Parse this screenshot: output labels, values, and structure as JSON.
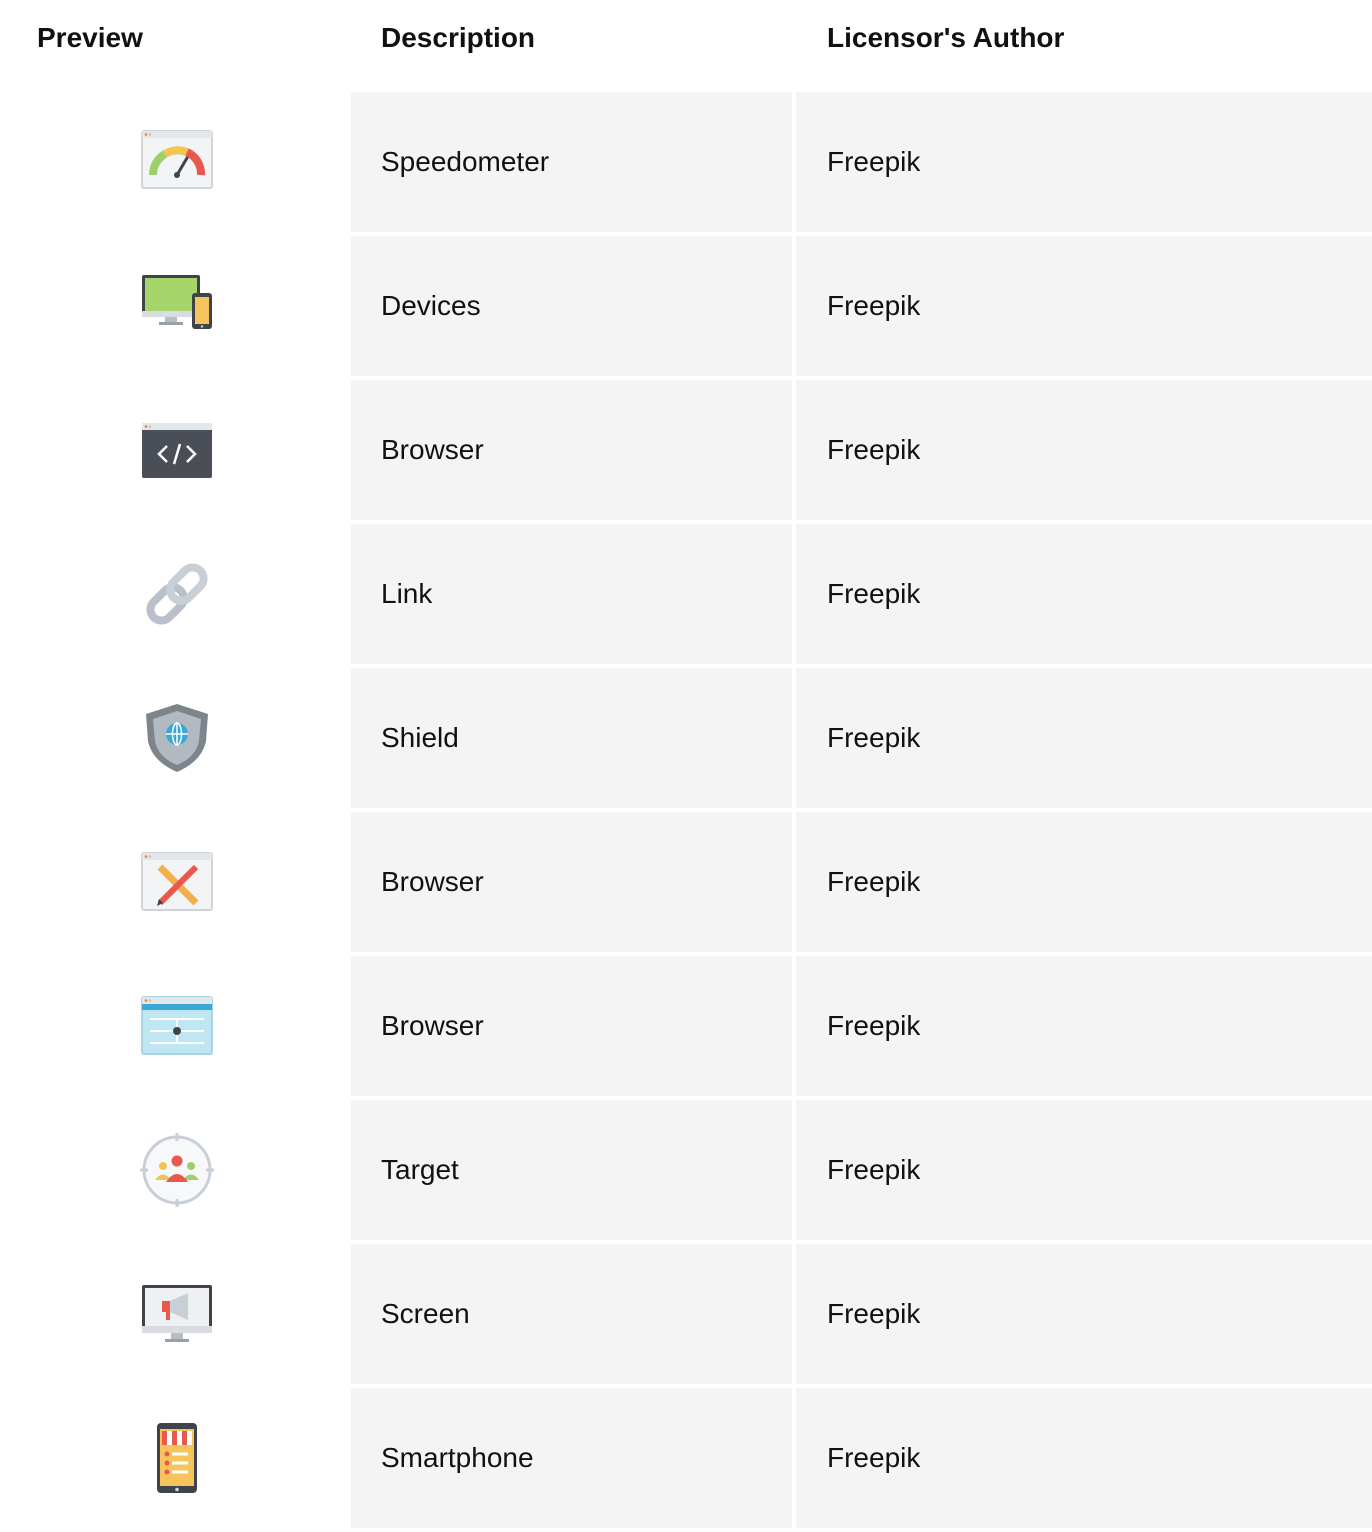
{
  "table": {
    "headers": {
      "preview": "Preview",
      "description": "Description",
      "author": "Licensor's Author"
    },
    "rows": [
      {
        "icon": "speedometer-icon",
        "description": "Speedometer",
        "author": "Freepik"
      },
      {
        "icon": "devices-icon",
        "description": "Devices",
        "author": "Freepik"
      },
      {
        "icon": "code-browser-icon",
        "description": "Browser",
        "author": "Freepik"
      },
      {
        "icon": "link-icon",
        "description": "Link",
        "author": "Freepik"
      },
      {
        "icon": "shield-icon",
        "description": "Shield",
        "author": "Freepik"
      },
      {
        "icon": "design-browser-icon",
        "description": "Browser",
        "author": "Freepik"
      },
      {
        "icon": "sitemap-browser-icon",
        "description": "Browser",
        "author": "Freepik"
      },
      {
        "icon": "target-audience-icon",
        "description": "Target",
        "author": "Freepik"
      },
      {
        "icon": "screen-megaphone-icon",
        "description": "Screen",
        "author": "Freepik"
      },
      {
        "icon": "smartphone-shop-icon",
        "description": "Smartphone",
        "author": "Freepik"
      }
    ]
  }
}
